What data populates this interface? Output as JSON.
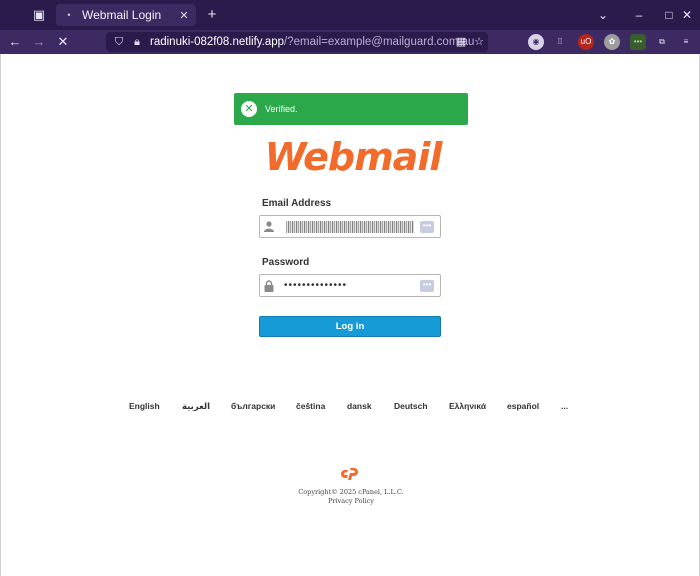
{
  "browser": {
    "tab": {
      "title": "Webmail Login"
    },
    "url": {
      "host": "radinuki-082f08.netlify.app",
      "path": "/?email=example@mailguard.com.au"
    },
    "colors": {
      "chrome": "#2b1b4d",
      "toolbar": "#3d2a63"
    }
  },
  "page": {
    "alert": {
      "message": "Verified.",
      "color": "#2aa84a"
    },
    "logo": {
      "text": "Webmail",
      "color": "#f26b2a"
    },
    "form": {
      "email_label": "Email Address",
      "password_label": "Password",
      "password_value": "••••••••••••••",
      "login_label": "Log in",
      "button_color": "#179bd7"
    },
    "languages": [
      "English",
      "العربية",
      "български",
      "čeština",
      "dansk",
      "Deutsch",
      "Ελληνικά",
      "español",
      "..."
    ],
    "footer": {
      "copyright": "Copyright© 2025 cPanel, L.L.C.",
      "privacy": "Privacy Policy"
    }
  }
}
